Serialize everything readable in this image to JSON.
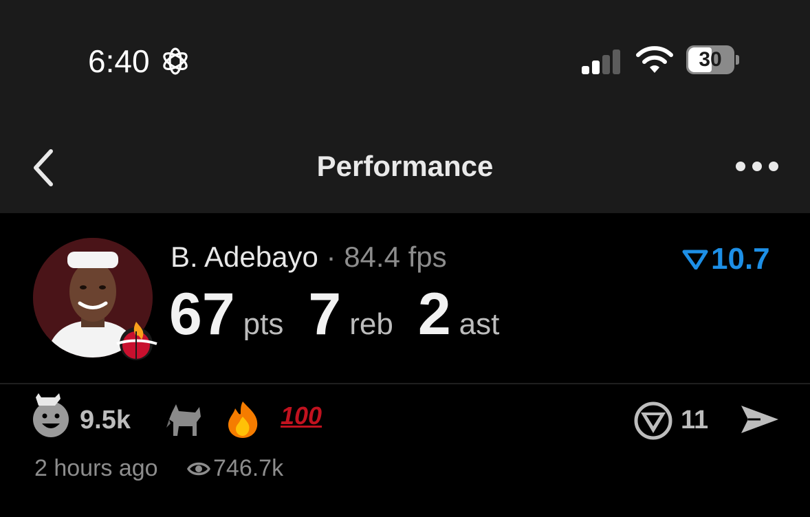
{
  "status_bar": {
    "time": "6:40",
    "battery_level": "30",
    "icons": [
      "openai-logo-icon",
      "signal-icon",
      "wifi-icon",
      "battery-icon"
    ]
  },
  "nav": {
    "title": "Performance",
    "icons": [
      "chevron-left-icon",
      "more-dots-icon"
    ]
  },
  "player": {
    "name": "B. Adebayo",
    "separator": "·",
    "fps": "84.4 fps",
    "team_logo": "miami-heat-logo",
    "stats": [
      {
        "value": "67",
        "unit": "pts"
      },
      {
        "value": "7",
        "unit": "reb"
      },
      {
        "value": "2",
        "unit": "ast"
      }
    ],
    "badge_value": "10.7",
    "badge_color": "#1d8fe6"
  },
  "engagement": {
    "reaction_count": "9.5k",
    "reactions": [
      "goat-smiley-icon",
      "goat-emoji",
      "fire-emoji",
      "hundred-emoji"
    ],
    "hundred_text": "100",
    "comment_count": "11",
    "posted": "2 hours ago",
    "views": "746.7k"
  },
  "colors": {
    "background": "#000000",
    "header_bg": "#1b1b1b",
    "accent_blue": "#1d8fe6",
    "muted_text": "#8d8d8d"
  }
}
